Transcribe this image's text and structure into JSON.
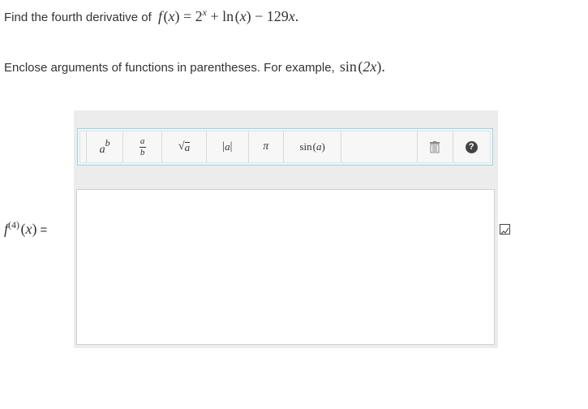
{
  "question": {
    "prefix": "Find the fourth derivative of",
    "function": {
      "name": "f",
      "arg": "x",
      "base": "2",
      "exponent": "x",
      "log_name": "ln",
      "coef": "129"
    },
    "instruction": "Enclose arguments of functions in parentheses. For example,",
    "example": {
      "func": "sin",
      "arg": "2x"
    }
  },
  "toolbar": {
    "power_base": "a",
    "power_exp": "b",
    "frac_num": "a",
    "frac_den": "b",
    "sqrt_arg": "a",
    "abs_arg": "a",
    "pi": "π",
    "sin_func": "sin",
    "sin_arg": "a",
    "help_glyph": "?"
  },
  "answer": {
    "label_func": "f",
    "label_order": "4",
    "label_arg": "x",
    "equals": "=",
    "value": ""
  },
  "colors": {
    "toolbar_border": "#9fd2e8",
    "panel_bg": "#ececec",
    "help_bg": "#444444"
  }
}
